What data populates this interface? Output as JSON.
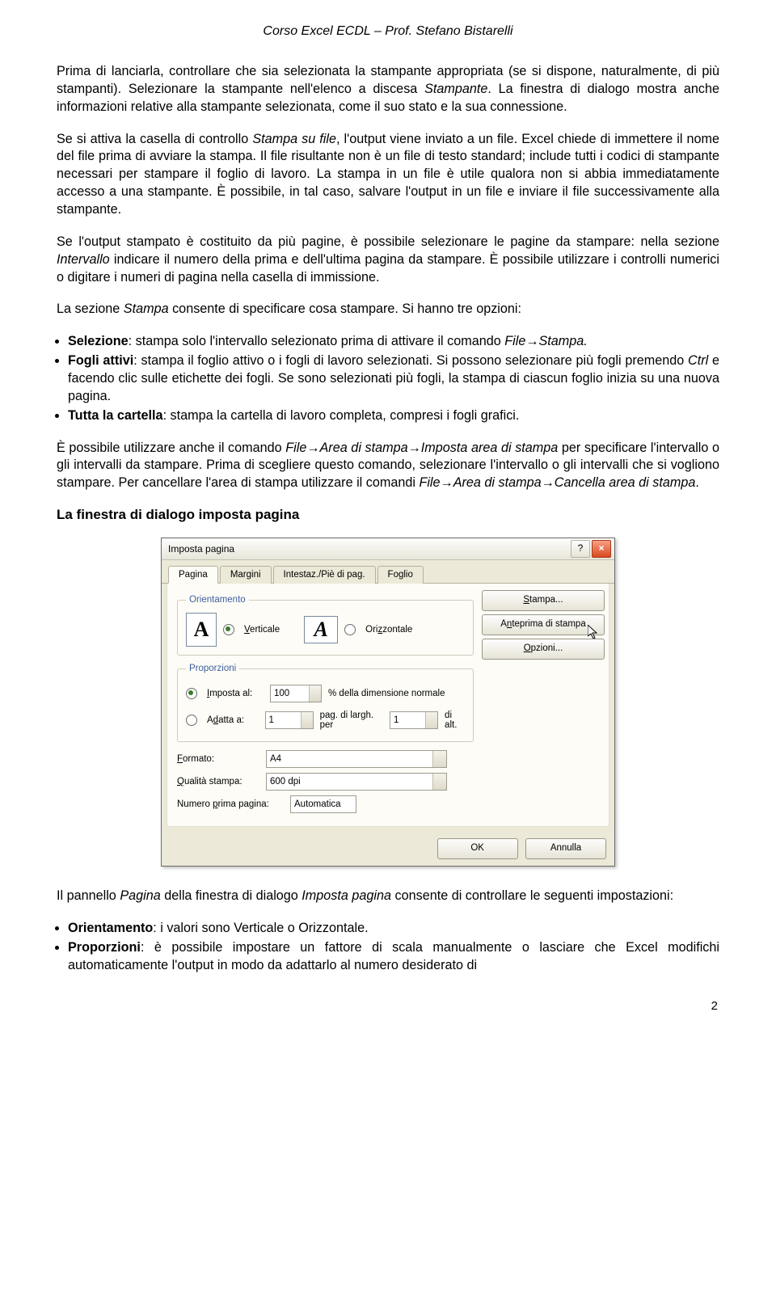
{
  "header": "Corso Excel ECDL – Prof. Stefano Bistarelli",
  "para1a": "Prima di lanciarla, controllare che sia selezionata la stampante appropriata (se si dispone, naturalmente, di più stampanti). Selezionare la stampante nell'elenco a discesa ",
  "para1_i1": "Stampante",
  "para1b": ". La finestra di dialogo mostra anche informazioni relative alla stampante selezionata, come il suo stato e la sua connessione.",
  "para2a": "Se si attiva la casella di controllo ",
  "para2_i1": "Stampa su file",
  "para2b": ", l'output viene inviato a un file. Excel chiede di immettere il nome del file prima di avviare la stampa. Il file risultante non è un file di testo standard; include tutti i codici di stampante necessari per stampare il foglio di lavoro. La stampa in un file è utile qualora non si abbia immediatamente accesso a una stampante. È possibile, in tal caso, salvare l'output in un file e inviare il file successivamente alla stampante.",
  "para3a": "Se l'output stampato è costituito da più pagine, è possibile selezionare le pagine da stampare: nella sezione ",
  "para3_i1": "Intervallo",
  "para3b": " indicare il numero della prima e dell'ultima pagina da stampare. È possibile utilizzare i controlli numerici o digitare i numeri di pagina nella casella di immissione.",
  "para4a": "La sezione ",
  "para4_i1": "Stampa",
  "para4b": " consente di specificare cosa stampare. Si hanno tre opzioni:",
  "opt1_b": "Selezione",
  "opt1_rest": ": stampa solo l'intervallo selezionato prima di attivare il comando ",
  "opt1_i": "File→Stampa.",
  "opt2_b": "Fogli attivi",
  "opt2_rest": ": stampa il foglio attivo o i fogli di lavoro selezionati. Si possono selezionare più fogli premendo ",
  "opt2_i": "Ctrl",
  "opt2_rest2": " e facendo clic sulle etichette dei fogli. Se sono selezionati più fogli, la stampa di ciascun foglio inizia su una nuova pagina.",
  "opt3_b": "Tutta la cartella",
  "opt3_rest": ": stampa la cartella di lavoro completa, compresi i fogli grafici.",
  "para5a": "È possibile utilizzare anche il comando ",
  "para5_i1": "File→Area di stampa→Imposta area di stampa",
  "para5b": " per specificare l'intervallo o gli intervalli da stampare. Prima di scegliere questo comando, selezionare l'intervallo o gli intervalli che si vogliono stampare. Per cancellare l'area di stampa utilizzare il comandi ",
  "para5_i2": "File→Area di stampa→Cancella area di stampa",
  "para5c": ".",
  "section_title": "La finestra di dialogo imposta pagina",
  "para6a": "Il pannello ",
  "para6_i1": "Pagina",
  "para6b": " della finestra di dialogo ",
  "para6_i2": "Imposta pagina",
  "para6c": " consente di controllare le seguenti impostazioni:",
  "b1_b": "Orientamento",
  "b1_rest": ": i valori sono Verticale o Orizzontale.",
  "b2_b": "Proporzioni",
  "b2_rest": ": è possibile impostare un fattore di scala manualmente o lasciare che Excel modifichi automaticamente l'output in modo da adattarlo al numero desiderato di",
  "dialog": {
    "title": "Imposta pagina",
    "help": "?",
    "close": "×",
    "tabs": {
      "pagina": "Pagina",
      "margini": "Margini",
      "intest": "Intestaz./Piè di pag.",
      "foglio": "Foglio"
    },
    "grp_orient": "Orientamento",
    "orient_v": "Verticale",
    "orient_h": "Orizzontale",
    "btn_stampa": "Stampa...",
    "btn_anteprima": "Anteprima di stampa",
    "btn_opzioni": "Opzioni...",
    "grp_prop": "Proporzioni",
    "imposta": "Imposta al:",
    "imposta_val": "100",
    "imposta_suffix": "% della dimensione normale",
    "adatta": "Adatta a:",
    "adatta_v1": "1",
    "adatta_mid": "pag. di largh. per",
    "adatta_v2": "1",
    "adatta_suffix": "di alt.",
    "formato_l": "Formato:",
    "formato_v": "A4",
    "qualita_l": "Qualità stampa:",
    "qualita_v": "600 dpi",
    "num_l": "Numero prima pagina:",
    "num_v": "Automatica",
    "ok": "OK",
    "annulla": "Annulla"
  },
  "pagenum": "2"
}
